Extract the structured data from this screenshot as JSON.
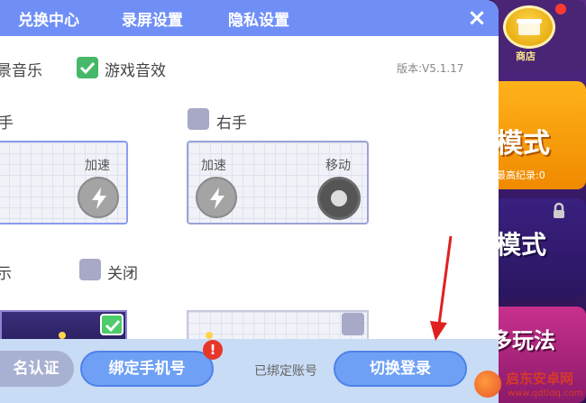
{
  "tabs": [
    {
      "label": "兑换中心"
    },
    {
      "label": "录屏设置"
    },
    {
      "label": "隐私设置"
    }
  ],
  "close_icon": "×",
  "audio": {
    "music_label": "景音乐",
    "sfx_label": "游戏音效",
    "sfx_checked": true
  },
  "version": "版本:V5.1.17",
  "controls": {
    "left_hand_label": "手",
    "right_hand_label": "右手",
    "accelerate_label": "加速",
    "move_label": "移动"
  },
  "display": {
    "left_label": "示",
    "off_label": "关闭"
  },
  "bottom": {
    "realname_label": "名认证",
    "bind_phone_label": "绑定手机号",
    "bind_alert": "!",
    "bound_account_label": "已绑定账号",
    "switch_login_label": "切换登录"
  },
  "game": {
    "shop_label": "商店",
    "mode1_label": "模式",
    "mode1_sub": "最高纪录:0",
    "mode2_label": "模式",
    "mode3_label": "多玩法"
  },
  "watermark": {
    "title": "启东安卓网",
    "url": "www.qdtldq.com"
  },
  "colors": {
    "tabbar": "#6f8ff7",
    "check_on": "#45b86a",
    "check_off": "#a8a9c6",
    "button_blue": "#6fa0f5",
    "bottom_bar": "#c8dcf6",
    "alert_red": "#e8362a"
  }
}
